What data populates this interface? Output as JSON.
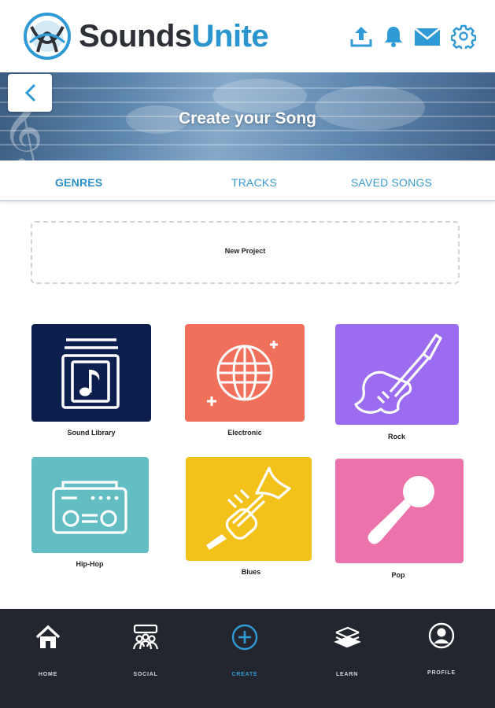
{
  "app": {
    "brand_part1": "Sounds",
    "brand_part2": "Unite",
    "brand_color": "#2a95cf"
  },
  "header_icons": [
    "upload-icon",
    "bell-icon",
    "mail-icon",
    "settings-gear-icon"
  ],
  "banner": {
    "title": "Create your Song",
    "back_icon": "chevron-left-icon"
  },
  "tabs": [
    {
      "label": "GENRES",
      "active": true
    },
    {
      "label": "TRACKS",
      "active": false
    },
    {
      "label": "SAVED SONGS",
      "active": false
    }
  ],
  "new_project": {
    "label": "New Project"
  },
  "genres": [
    {
      "label": "Sound Library",
      "color": "#0d1f4f",
      "icon": "music-library-icon"
    },
    {
      "label": "Electronic",
      "color": "#f1705c",
      "icon": "disco-ball-icon"
    },
    {
      "label": "Rock",
      "color": "#9b6cf0",
      "icon": "electric-guitar-icon"
    },
    {
      "label": "Hip-Hop",
      "color": "#62bec3",
      "icon": "boombox-icon"
    },
    {
      "label": "Blues",
      "color": "#f2c21b",
      "icon": "trumpet-icon"
    },
    {
      "label": "Pop",
      "color": "#ec72ab",
      "icon": "microphone-icon"
    }
  ],
  "bottom_nav": [
    {
      "label": "HOME",
      "icon": "home-icon",
      "active": false
    },
    {
      "label": "SOCIAL",
      "icon": "social-group-icon",
      "active": false
    },
    {
      "label": "CREATE",
      "icon": "plus-circle-icon",
      "active": true
    },
    {
      "label": "LEARN",
      "icon": "books-icon",
      "active": false
    },
    {
      "label": "PROFILE",
      "icon": "profile-icon",
      "active": false
    }
  ],
  "colors": {
    "accent": "#2f9ad6",
    "nav_background": "#23262e"
  }
}
